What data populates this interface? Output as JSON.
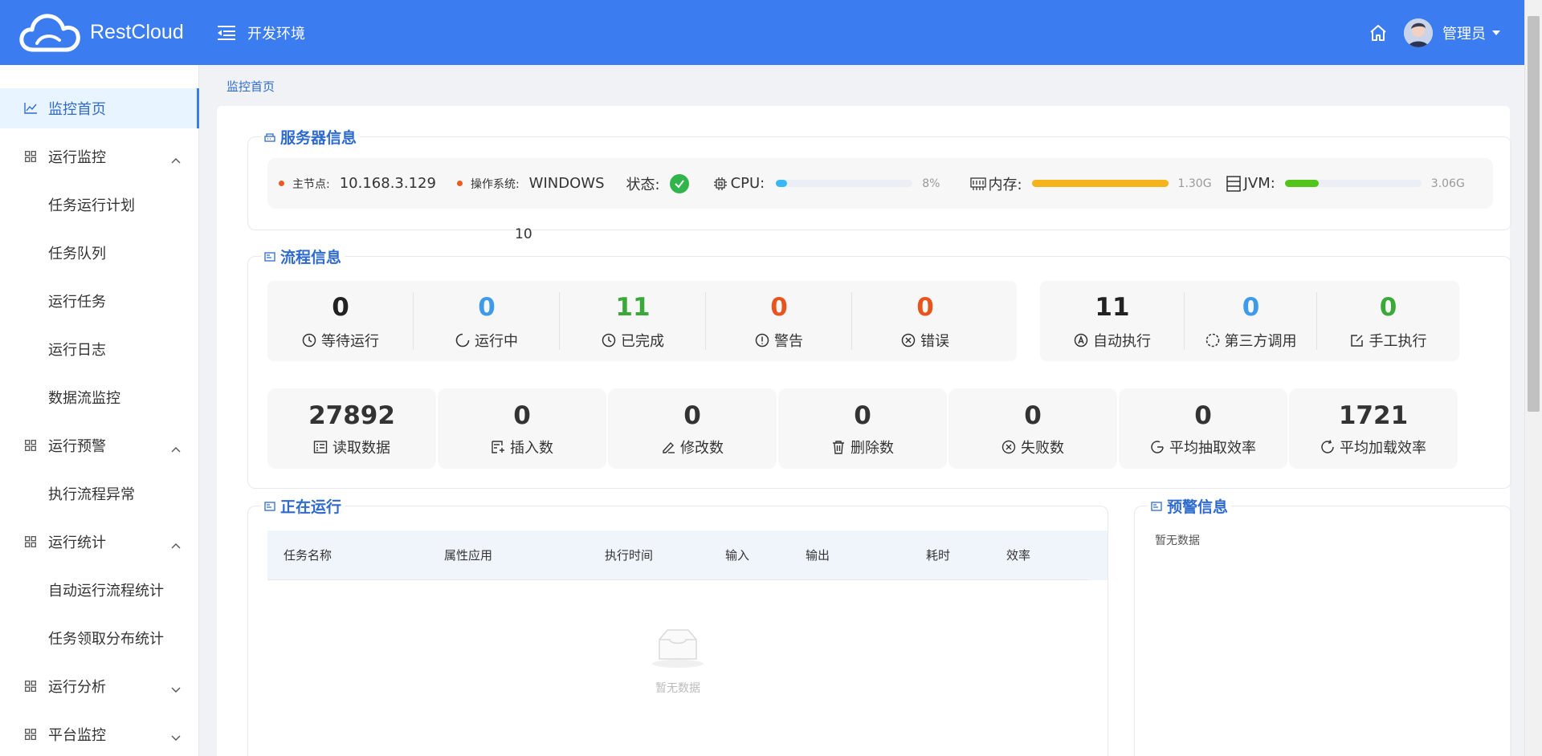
{
  "header": {
    "logo_text": "RestCloud",
    "env_label": "开发环境",
    "user_name": "管理员"
  },
  "sidebar": {
    "items": [
      {
        "label": "监控首页",
        "type": "item",
        "active": true,
        "icon": "chart-line-icon"
      },
      {
        "label": "运行监控",
        "type": "group",
        "expanded": true,
        "icon": "grid-icon"
      },
      {
        "label": "任务运行计划",
        "type": "sub"
      },
      {
        "label": "任务队列",
        "type": "sub"
      },
      {
        "label": "运行任务",
        "type": "sub"
      },
      {
        "label": "运行日志",
        "type": "sub"
      },
      {
        "label": "数据流监控",
        "type": "sub"
      },
      {
        "label": "运行预警",
        "type": "group",
        "expanded": true,
        "icon": "grid-icon"
      },
      {
        "label": "执行流程异常",
        "type": "sub"
      },
      {
        "label": "运行统计",
        "type": "group",
        "expanded": true,
        "icon": "grid-icon"
      },
      {
        "label": "自动运行流程统计",
        "type": "sub"
      },
      {
        "label": "任务领取分布统计",
        "type": "sub"
      },
      {
        "label": "运行分析",
        "type": "group",
        "expanded": false,
        "icon": "grid-icon"
      },
      {
        "label": "平台监控",
        "type": "group",
        "expanded": false,
        "icon": "grid-icon"
      }
    ]
  },
  "breadcrumb": "监控首页",
  "server_info": {
    "title": "服务器信息",
    "main_node_label": "主节点:",
    "main_node_value": "10.168.3.129",
    "os_label": "操作系统:",
    "os_value": "WINDOWS",
    "status_label": "状态:",
    "cpu_label": "CPU:",
    "cpu_percent": "8%",
    "cpu_fill": 0.08,
    "mem_label": "内存:",
    "mem_value": "1.30G",
    "mem_fill": 1.0,
    "jvm_label": "JVM:",
    "jvm_value": "3.06G",
    "jvm_fill": 0.25,
    "stray_text": "10"
  },
  "flow_info": {
    "title": "流程信息",
    "group1": [
      {
        "num": "0",
        "label": "等待运行",
        "color": "#222222",
        "icon": "clock-icon"
      },
      {
        "num": "0",
        "label": "运行中",
        "color": "#3d9be9",
        "icon": "loading-icon"
      },
      {
        "num": "11",
        "label": "已完成",
        "color": "#3aa93a",
        "icon": "clock-icon"
      },
      {
        "num": "0",
        "label": "警告",
        "color": "#e8541e",
        "icon": "warning-icon"
      },
      {
        "num": "0",
        "label": "错误",
        "color": "#e8541e",
        "icon": "error-icon"
      }
    ],
    "group2": [
      {
        "num": "11",
        "label": "自动执行",
        "color": "#222222",
        "icon": "auto-icon"
      },
      {
        "num": "0",
        "label": "第三方调用",
        "color": "#3d9be9",
        "icon": "loading-icon"
      },
      {
        "num": "0",
        "label": "手工执行",
        "color": "#3aa93a",
        "icon": "edit-icon"
      }
    ],
    "boxes": [
      {
        "num": "27892",
        "label": "读取数据",
        "icon": "read-data-icon"
      },
      {
        "num": "0",
        "label": "插入数",
        "icon": "insert-icon"
      },
      {
        "num": "0",
        "label": "修改数",
        "icon": "modify-icon"
      },
      {
        "num": "0",
        "label": "删除数",
        "icon": "trash-icon"
      },
      {
        "num": "0",
        "label": "失败数",
        "icon": "error-icon"
      },
      {
        "num": "0",
        "label": "平均抽取效率",
        "icon": "refresh-icon"
      },
      {
        "num": "1721",
        "label": "平均加载效率",
        "icon": "refresh-icon"
      }
    ]
  },
  "running": {
    "title": "正在运行",
    "columns": [
      "任务名称",
      "属性应用",
      "执行时间",
      "输入",
      "输出",
      "耗时",
      "效率"
    ],
    "empty_text": "暂无数据"
  },
  "alerts": {
    "title": "预警信息",
    "empty_text": "暂无数据"
  },
  "colors": {
    "header_bg": "#3b7cf0",
    "accent": "#2f6bcf",
    "cpu_bar": "#3ab6f5",
    "mem_bar": "#f5b31c",
    "jvm_bar": "#52c41a",
    "status_ok": "#31b44b"
  }
}
